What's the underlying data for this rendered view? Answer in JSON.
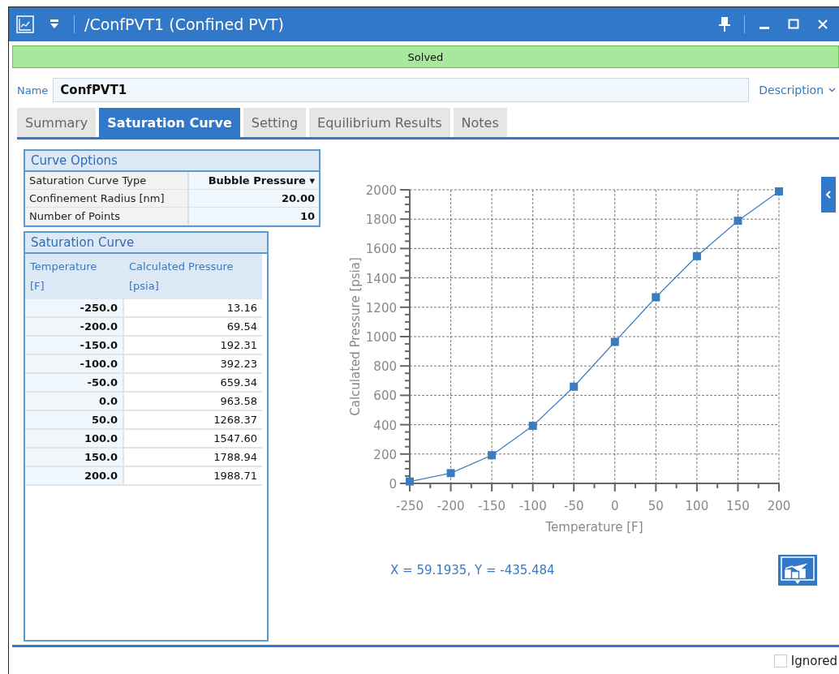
{
  "window": {
    "title": "/ConfPVT1 (Confined PVT)"
  },
  "status": {
    "text": "Solved",
    "solved": true
  },
  "name_field": {
    "label": "Name",
    "value": "ConfPVT1"
  },
  "description_link": "Description",
  "tabs": [
    {
      "label": "Summary",
      "selected": false
    },
    {
      "label": "Saturation Curve",
      "selected": true
    },
    {
      "label": "Setting",
      "selected": false
    },
    {
      "label": "Equilibrium Results",
      "selected": false
    },
    {
      "label": "Notes",
      "selected": false
    }
  ],
  "curve_options": {
    "title": "Curve Options",
    "rows": [
      {
        "label": "Saturation Curve Type",
        "value": "Bubble Pressure",
        "kind": "dropdown",
        "caret": "▾"
      },
      {
        "label": "Confinement Radius [nm]",
        "value": "20.00",
        "kind": "number"
      },
      {
        "label": "Number of Points",
        "value": "10",
        "kind": "number"
      }
    ]
  },
  "saturation_curve": {
    "title": "Saturation Curve",
    "columns": [
      {
        "line1": "Temperature",
        "line2": "[F]"
      },
      {
        "line1": "Calculated Pressure",
        "line2": "[psia]"
      }
    ],
    "rows": [
      [
        "-250.0",
        "13.16"
      ],
      [
        "-200.0",
        "69.54"
      ],
      [
        "-150.0",
        "192.31"
      ],
      [
        "-100.0",
        "392.23"
      ],
      [
        "-50.0",
        "659.34"
      ],
      [
        "0.0",
        "963.58"
      ],
      [
        "50.0",
        "1268.37"
      ],
      [
        "100.0",
        "1547.60"
      ],
      [
        "150.0",
        "1788.94"
      ],
      [
        "200.0",
        "1988.71"
      ]
    ]
  },
  "chart": {
    "chart_data": {
      "type": "line",
      "xlabel": "Temperature [F]",
      "ylabel": "Calculated Pressure [psia]",
      "x": [
        -250,
        -200,
        -150,
        -100,
        -50,
        0,
        50,
        100,
        150,
        200
      ],
      "series": [
        {
          "color": "#3b7bbf",
          "marker": "square",
          "values": [
            13,
            70,
            192,
            392,
            659,
            964,
            1268,
            1548,
            1789,
            1989
          ]
        }
      ],
      "grid": true,
      "xlim": [
        -250,
        200
      ],
      "ylim": [
        0,
        2000
      ],
      "xticks": [
        -250,
        -200,
        -150,
        -100,
        -50,
        0,
        50,
        100,
        150,
        200
      ],
      "yticks": [
        0,
        200,
        400,
        600,
        800,
        1000,
        1200,
        1400,
        1600,
        1800,
        2000
      ]
    },
    "cursor_readout": "X = 59.1935, Y = -435.484"
  },
  "footer": {
    "ignored": {
      "label": "Ignored",
      "checked": false
    }
  }
}
